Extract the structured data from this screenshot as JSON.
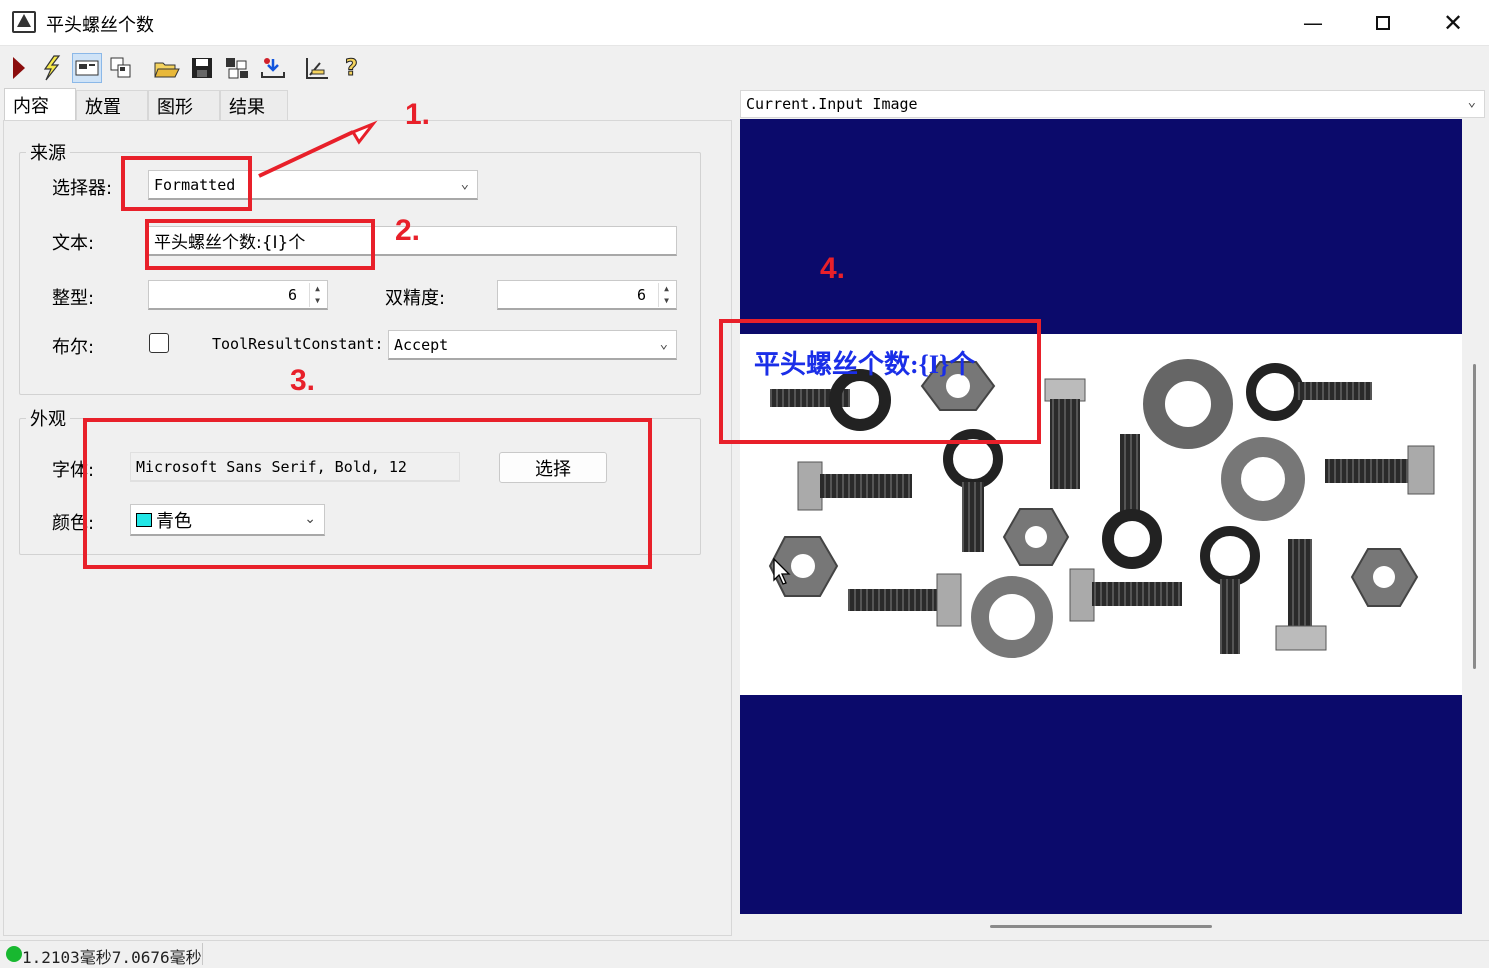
{
  "window": {
    "title": "平头螺丝个数",
    "icon": "app-logo-icon",
    "controls": [
      "minimize-icon",
      "maximize-icon",
      "close-icon"
    ]
  },
  "toolbar": {
    "buttons": [
      "run-icon",
      "lightning-icon",
      "display-icon",
      "copy-icon",
      "open-folder-icon",
      "save-icon",
      "grid-icon",
      "import-icon",
      "measure-icon",
      "help-icon"
    ]
  },
  "tabs": [
    "内容",
    "放置",
    "图形",
    "结果"
  ],
  "source": {
    "group_title": "来源",
    "selector_label": "选择器:",
    "selector_value": "Formatted",
    "text_label": "文本:",
    "text_value": "平头螺丝个数:{I}个",
    "int_label": "整型:",
    "int_value": "6",
    "double_label": "双精度:",
    "double_value": "6",
    "bool_label": "布尔:",
    "bool_checked": false,
    "tool_result_label": "ToolResultConstant:",
    "tool_result_value": "Accept"
  },
  "appearance": {
    "group_title": "外观",
    "font_label": "字体:",
    "font_value": "Microsoft Sans Serif, Bold, 12",
    "select_button": "选择",
    "color_label": "颜色:",
    "color_value": "青色",
    "color_swatch": "#22e6e6"
  },
  "annotations": {
    "n1": "1.",
    "n2": "2.",
    "n3": "3.",
    "n4": "4.",
    "color": "#e8202a"
  },
  "image_view": {
    "selector": "Current.Input Image",
    "overlay_text": "平头螺丝个数:{I}个",
    "overlay_color": "#1a2ee8",
    "background": "#0b0a6b"
  },
  "status": {
    "text": "1.2103毫秒7.0676毫秒",
    "indicator_color": "#18b830"
  }
}
